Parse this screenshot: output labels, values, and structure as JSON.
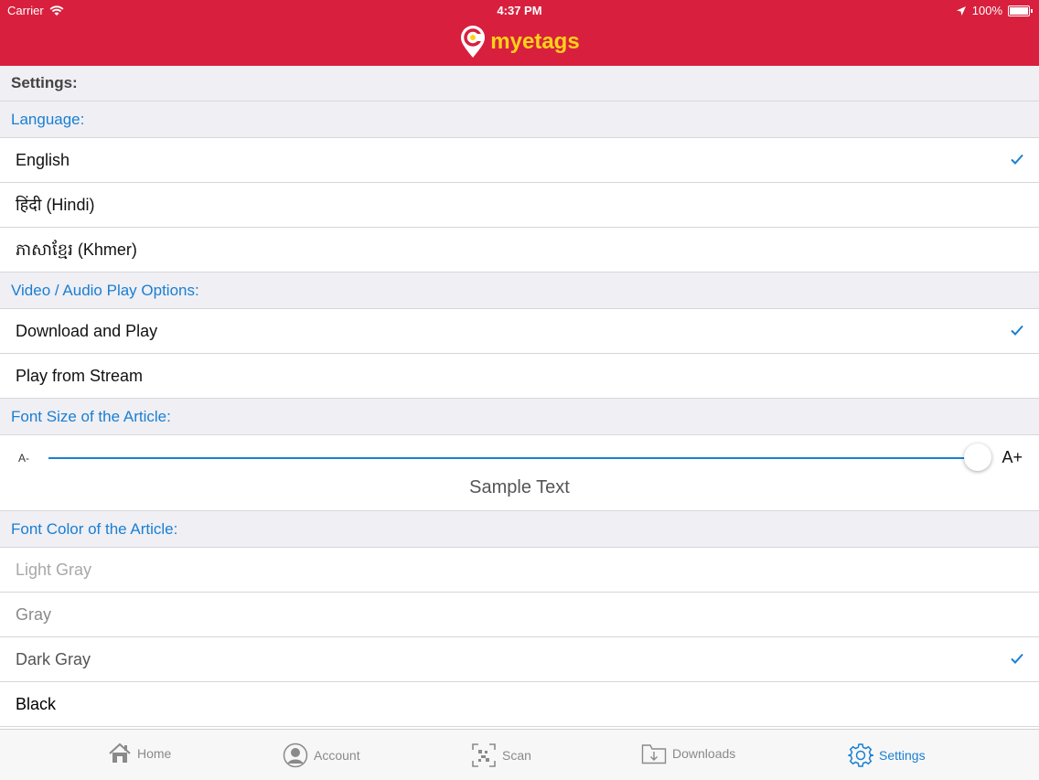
{
  "status_bar": {
    "carrier": "Carrier",
    "time": "4:37 PM",
    "battery": "100%"
  },
  "brand": {
    "name": "myetags"
  },
  "settings": {
    "title": "Settings:",
    "language": {
      "header": "Language:",
      "options": [
        "English",
        "हिंदी (Hindi)",
        "ភាសាខ្មែរ (Khmer)"
      ],
      "selected": "English"
    },
    "play_options": {
      "header": "Video / Audio Play Options:",
      "options": [
        "Download and Play",
        "Play from Stream"
      ],
      "selected": "Download and Play"
    },
    "font_size": {
      "header": "Font Size of the Article:",
      "min_label": "A-",
      "max_label": "A+",
      "level": 1.0,
      "sample_text": "Sample Text"
    },
    "font_color": {
      "header": "Font Color of the Article:",
      "options": [
        "Light Gray",
        "Gray",
        "Dark Gray",
        "Black"
      ],
      "option_colors": [
        "#a8a8a8",
        "#8a8a8a",
        "#555555",
        "#000000"
      ],
      "selected": "Dark Gray"
    }
  },
  "tabbar": {
    "items": [
      {
        "label": "Home",
        "icon": "home-icon"
      },
      {
        "label": "Account",
        "icon": "account-icon"
      },
      {
        "label": "Scan",
        "icon": "scan-icon"
      },
      {
        "label": "Downloads",
        "icon": "downloads-icon"
      },
      {
        "label": "Settings",
        "icon": "gear-icon"
      }
    ],
    "active": "Settings"
  },
  "colors": {
    "header": "#d8203e",
    "brand_text": "#ffd21a",
    "accent": "#1a7fd2"
  }
}
